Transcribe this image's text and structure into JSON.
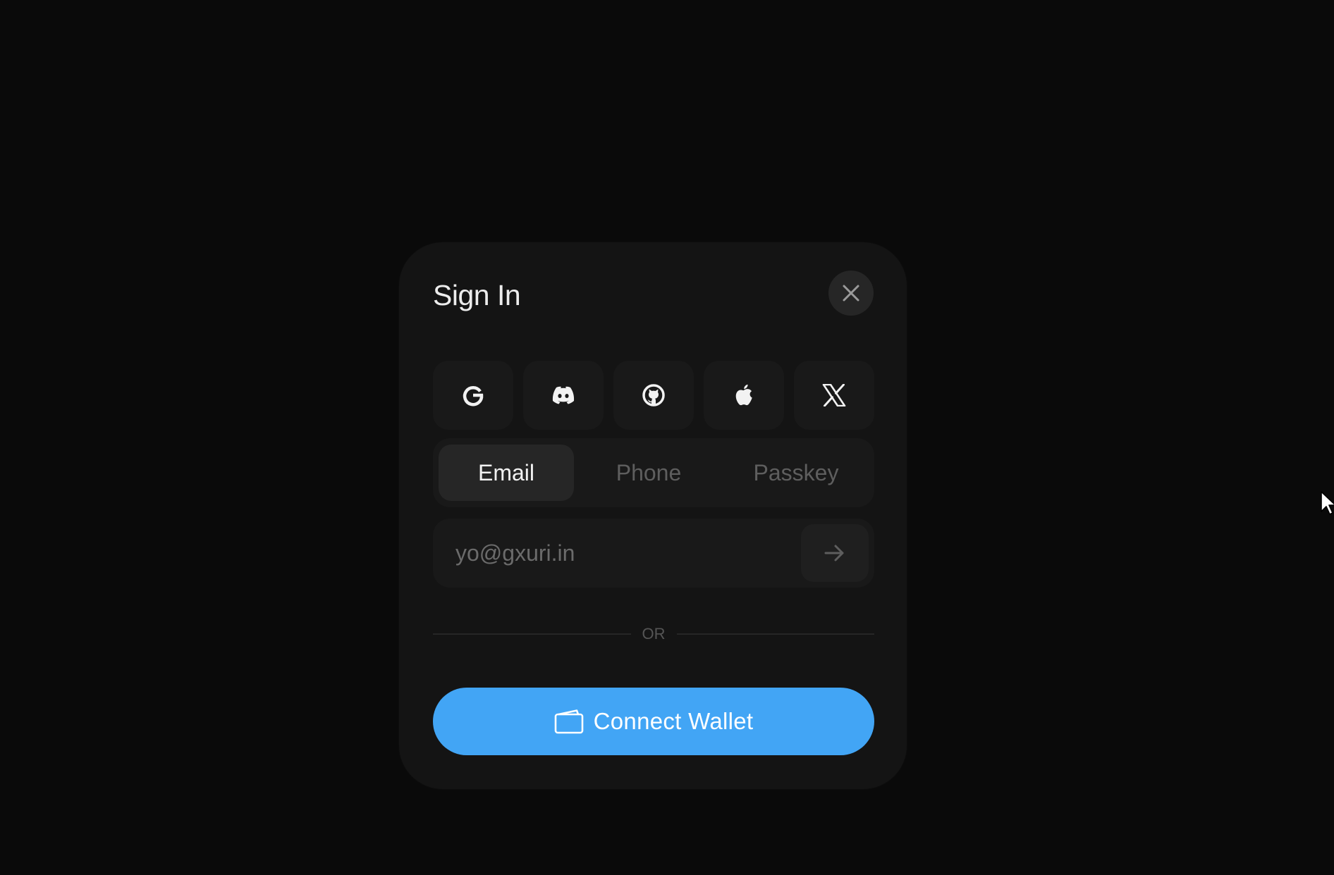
{
  "modal": {
    "title": "Sign In"
  },
  "social": [
    {
      "name": "google",
      "icon": "google-icon"
    },
    {
      "name": "discord",
      "icon": "discord-icon"
    },
    {
      "name": "github",
      "icon": "github-icon"
    },
    {
      "name": "apple",
      "icon": "apple-icon"
    },
    {
      "name": "x",
      "icon": "x-icon"
    }
  ],
  "tabs": [
    {
      "label": "Email",
      "active": true
    },
    {
      "label": "Phone",
      "active": false
    },
    {
      "label": "Passkey",
      "active": false
    }
  ],
  "email_input": {
    "value": "",
    "placeholder": "yo@gxuri.in"
  },
  "divider": {
    "label": "OR"
  },
  "connect_wallet": {
    "label": "Connect Wallet",
    "icon": "wallet-icon"
  },
  "colors": {
    "background": "#0a0a0a",
    "modal": "#141414",
    "accent": "#42a5f5"
  }
}
